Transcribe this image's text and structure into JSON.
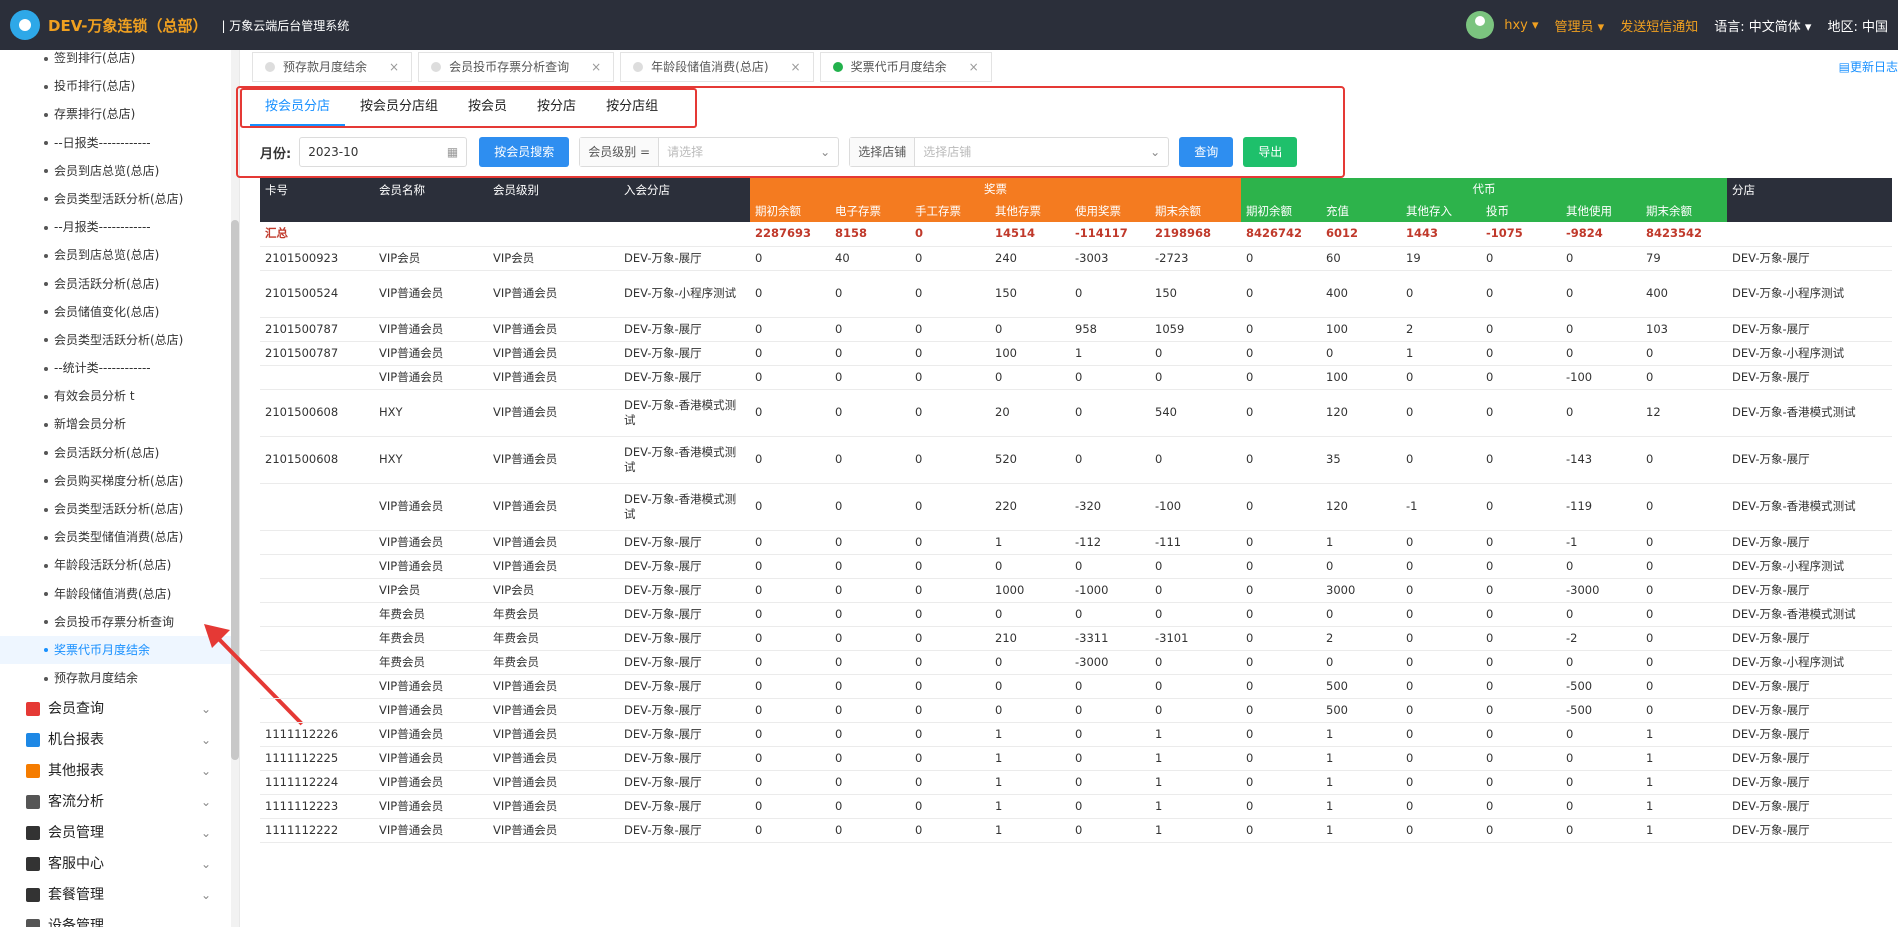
{
  "header": {
    "brand": "DEV-万象连锁（总部）",
    "subtitle": "| 万象云端后台管理系统",
    "user": "hxy",
    "role": "管理员",
    "sms": "发送短信通知",
    "lang_label": "语言:",
    "lang_value": "中文简体",
    "region_label": "地区:",
    "region_value": "中国"
  },
  "sidebar": {
    "sub_items": [
      "签到排行(总店)",
      "投币排行(总店)",
      "存票排行(总店)",
      "--日报类------------",
      "会员到店总览(总店)",
      "会员类型活跃分析(总店)",
      "--月报类------------",
      "会员到店总览(总店)",
      "会员活跃分析(总店)",
      "会员储值变化(总店)",
      "会员类型活跃分析(总店)",
      "--统计类------------",
      "有效会员分析 t",
      "新增会员分析",
      "会员活跃分析(总店)",
      "会员购买梯度分析(总店)",
      "会员类型活跃分析(总店)",
      "会员类型储值消费(总店)",
      "年龄段活跃分析(总店)",
      "年龄段储值消费(总店)",
      "会员投币存票分析查询",
      "奖票代币月度结余",
      "预存款月度结余"
    ],
    "menus": [
      "会员查询",
      "机台报表",
      "其他报表",
      "客流分析",
      "会员管理",
      "客服中心",
      "套餐管理",
      "设备管理"
    ]
  },
  "tabs": [
    "预存款月度结余",
    "会员投币存票分析查询",
    "年龄段储值消费(总店)",
    "奖票代币月度结余"
  ],
  "update_log": "更新日志",
  "subtabs": [
    "按会员分店",
    "按会员分店组",
    "按会员",
    "按分店",
    "按分店组"
  ],
  "filters": {
    "month_label": "月份:",
    "month_value": "2023-10",
    "member_search": "按会员搜索",
    "level_label": "会员级别 =",
    "level_placeholder": "请选择",
    "store_label": "选择店铺",
    "store_placeholder": "选择店铺",
    "query": "查询",
    "export": "导出"
  },
  "table": {
    "headers": {
      "card": "卡号",
      "name": "会员名称",
      "level": "会员级别",
      "store": "入会分店",
      "ticket_group": "奖票",
      "coin_group": "代币",
      "branch": "分店",
      "ticket_cols": [
        "期初余额",
        "电子存票",
        "手工存票",
        "其他存票",
        "使用奖票",
        "期末余额"
      ],
      "coin_cols": [
        "期初余额",
        "充值",
        "其他存入",
        "投币",
        "其他使用",
        "期末余额"
      ]
    },
    "summary": [
      "汇总",
      "",
      "",
      "",
      "2287693",
      "8158",
      "0",
      "14514",
      "-114117",
      "2198968",
      "8426742",
      "6012",
      "1443",
      "-1075",
      "-9824",
      "8423542",
      ""
    ],
    "rows": [
      [
        "2101500923",
        "VIP会员",
        "VIP会员",
        "DEV-万象-展厅",
        "0",
        "40",
        "0",
        "240",
        "-3003",
        "-2723",
        "0",
        "60",
        "19",
        "0",
        "0",
        "79",
        "DEV-万象-展厅"
      ],
      [
        "2101500524",
        "VIP普通会员",
        "VIP普通会员",
        "DEV-万象-小程序测试",
        "0",
        "0",
        "0",
        "150",
        "0",
        "150",
        "0",
        "400",
        "0",
        "0",
        "0",
        "400",
        "DEV-万象-小程序测试"
      ],
      [
        "2101500787",
        "VIP普通会员",
        "VIP普通会员",
        "DEV-万象-展厅",
        "0",
        "0",
        "0",
        "0",
        "958",
        "1059",
        "0",
        "100",
        "2",
        "0",
        "0",
        "103",
        "DEV-万象-展厅"
      ],
      [
        "2101500787",
        "VIP普通会员",
        "VIP普通会员",
        "DEV-万象-展厅",
        "0",
        "0",
        "0",
        "100",
        "1",
        "0",
        "0",
        "0",
        "1",
        "0",
        "0",
        "0",
        "DEV-万象-小程序测试"
      ],
      [
        "",
        "VIP普通会员",
        "VIP普通会员",
        "DEV-万象-展厅",
        "0",
        "0",
        "0",
        "0",
        "0",
        "0",
        "0",
        "100",
        "0",
        "0",
        "-100",
        "0",
        "DEV-万象-展厅"
      ],
      [
        "2101500608",
        "HXY",
        "VIP普通会员",
        "DEV-万象-香港模式测试",
        "0",
        "0",
        "0",
        "20",
        "0",
        "540",
        "0",
        "120",
        "0",
        "0",
        "0",
        "12",
        "DEV-万象-香港模式测试"
      ],
      [
        "2101500608",
        "HXY",
        "VIP普通会员",
        "DEV-万象-香港模式测试",
        "0",
        "0",
        "0",
        "520",
        "0",
        "0",
        "0",
        "35",
        "0",
        "0",
        "-143",
        "0",
        "DEV-万象-展厅"
      ],
      [
        "",
        "VIP普通会员",
        "VIP普通会员",
        "DEV-万象-香港模式测试",
        "0",
        "0",
        "0",
        "220",
        "-320",
        "-100",
        "0",
        "120",
        "-1",
        "0",
        "-119",
        "0",
        "DEV-万象-香港模式测试"
      ],
      [
        "",
        "VIP普通会员",
        "VIP普通会员",
        "DEV-万象-展厅",
        "0",
        "0",
        "0",
        "1",
        "-112",
        "-111",
        "0",
        "1",
        "0",
        "0",
        "-1",
        "0",
        "DEV-万象-展厅"
      ],
      [
        "",
        "VIP普通会员",
        "VIP普通会员",
        "DEV-万象-展厅",
        "0",
        "0",
        "0",
        "0",
        "0",
        "0",
        "0",
        "0",
        "0",
        "0",
        "0",
        "0",
        "DEV-万象-小程序测试"
      ],
      [
        "",
        "VIP会员",
        "VIP会员",
        "DEV-万象-展厅",
        "0",
        "0",
        "0",
        "1000",
        "-1000",
        "0",
        "0",
        "3000",
        "0",
        "0",
        "-3000",
        "0",
        "DEV-万象-展厅"
      ],
      [
        "",
        "年费会员",
        "年费会员",
        "DEV-万象-展厅",
        "0",
        "0",
        "0",
        "0",
        "0",
        "0",
        "0",
        "0",
        "0",
        "0",
        "0",
        "0",
        "DEV-万象-香港模式测试"
      ],
      [
        "",
        "年费会员",
        "年费会员",
        "DEV-万象-展厅",
        "0",
        "0",
        "0",
        "210",
        "-3311",
        "-3101",
        "0",
        "2",
        "0",
        "0",
        "-2",
        "0",
        "DEV-万象-展厅"
      ],
      [
        "",
        "年费会员",
        "年费会员",
        "DEV-万象-展厅",
        "0",
        "0",
        "0",
        "0",
        "-3000",
        "0",
        "0",
        "0",
        "0",
        "0",
        "0",
        "0",
        "DEV-万象-小程序测试"
      ],
      [
        "",
        "VIP普通会员",
        "VIP普通会员",
        "DEV-万象-展厅",
        "0",
        "0",
        "0",
        "0",
        "0",
        "0",
        "0",
        "500",
        "0",
        "0",
        "-500",
        "0",
        "DEV-万象-展厅"
      ],
      [
        "",
        "VIP普通会员",
        "VIP普通会员",
        "DEV-万象-展厅",
        "0",
        "0",
        "0",
        "0",
        "0",
        "0",
        "0",
        "500",
        "0",
        "0",
        "-500",
        "0",
        "DEV-万象-展厅"
      ],
      [
        "1111112226",
        "VIP普通会员",
        "VIP普通会员",
        "DEV-万象-展厅",
        "0",
        "0",
        "0",
        "1",
        "0",
        "1",
        "0",
        "1",
        "0",
        "0",
        "0",
        "1",
        "DEV-万象-展厅"
      ],
      [
        "1111112225",
        "VIP普通会员",
        "VIP普通会员",
        "DEV-万象-展厅",
        "0",
        "0",
        "0",
        "1",
        "0",
        "1",
        "0",
        "1",
        "0",
        "0",
        "0",
        "1",
        "DEV-万象-展厅"
      ],
      [
        "1111112224",
        "VIP普通会员",
        "VIP普通会员",
        "DEV-万象-展厅",
        "0",
        "0",
        "0",
        "1",
        "0",
        "1",
        "0",
        "1",
        "0",
        "0",
        "0",
        "1",
        "DEV-万象-展厅"
      ],
      [
        "1111112223",
        "VIP普通会员",
        "VIP普通会员",
        "DEV-万象-展厅",
        "0",
        "0",
        "0",
        "1",
        "0",
        "1",
        "0",
        "1",
        "0",
        "0",
        "0",
        "1",
        "DEV-万象-展厅"
      ],
      [
        "1111112222",
        "VIP普通会员",
        "VIP普通会员",
        "DEV-万象-展厅",
        "0",
        "0",
        "0",
        "1",
        "0",
        "1",
        "0",
        "1",
        "0",
        "0",
        "0",
        "1",
        "DEV-万象-展厅"
      ]
    ]
  },
  "colors": {
    "header_bg": "#2b2f3a",
    "ticket_orange": "#f47b20",
    "coin_green": "#2db34b",
    "accent_blue": "#1890ff",
    "annotation_red": "#e53935"
  },
  "icons": [
    "cloud-logo-icon",
    "user-avatar-icon",
    "calendar-icon",
    "chevron-down-icon",
    "close-icon",
    "document-icon"
  ]
}
